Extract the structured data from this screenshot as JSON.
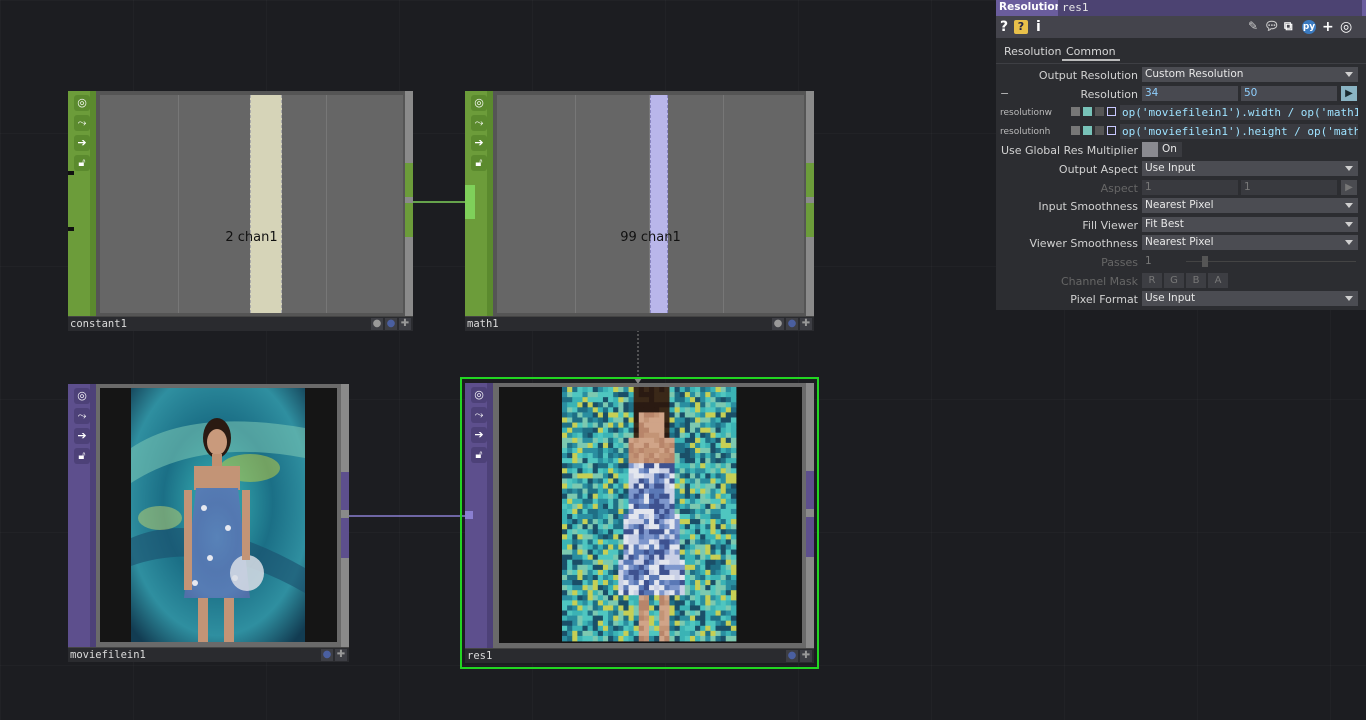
{
  "nodes": {
    "constant1": {
      "name": "constant1",
      "channel_label": "2 chan1"
    },
    "math1": {
      "name": "math1",
      "channel_label": "99 chan1"
    },
    "moviefilein1": {
      "name": "moviefilein1"
    },
    "res1": {
      "name": "res1"
    }
  },
  "params": {
    "op_type": "Resolution",
    "op_name": "res1",
    "tabs": [
      "Resolution",
      "Common"
    ],
    "active_tab": "Common",
    "rows": {
      "output_resolution": {
        "label": "Output Resolution",
        "value": "Custom Resolution"
      },
      "resolution": {
        "label": "Resolution",
        "w": "34",
        "h": "50"
      },
      "resolutionw": {
        "label": "resolutionw",
        "expr": "op('moviefilein1').width / op('math1"
      },
      "resolutionh": {
        "label": "resolutionh",
        "expr": "op('moviefilein1').height / op('math"
      },
      "global_res": {
        "label": "Use Global Res Multiplier",
        "value": "On"
      },
      "output_aspect": {
        "label": "Output Aspect",
        "value": "Use Input"
      },
      "aspect": {
        "label": "Aspect",
        "v1": "1",
        "v2": "1"
      },
      "input_smoothness": {
        "label": "Input Smoothness",
        "value": "Nearest Pixel"
      },
      "fill_viewer": {
        "label": "Fill Viewer",
        "value": "Fit Best"
      },
      "viewer_smoothness": {
        "label": "Viewer Smoothness",
        "value": "Nearest Pixel"
      },
      "passes": {
        "label": "Passes",
        "value": "1"
      },
      "channel_mask": {
        "label": "Channel Mask",
        "channels": [
          "R",
          "G",
          "B",
          "A"
        ]
      },
      "pixel_format": {
        "label": "Pixel Format",
        "value": "Use Input"
      }
    }
  },
  "colors": {
    "chop_green": "#6c9c3a",
    "top_purple": "#5d4f8d",
    "selected_outline": "#22d622"
  },
  "icons": [
    "help-icon",
    "python-help-icon",
    "info-icon",
    "edit-icon",
    "comment-icon",
    "clone-icon",
    "python-icon",
    "add-icon",
    "target-icon"
  ]
}
